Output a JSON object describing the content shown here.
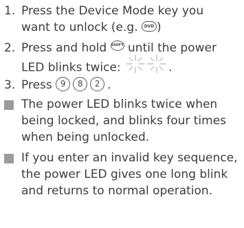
{
  "steps": [
    {
      "number": "1.",
      "line1": "Press the Device Mode key you",
      "line2_prefix": "want to unlock (e.g. ",
      "key_label": "DVD",
      "line2_suffix": ")"
    },
    {
      "number": "2.",
      "line1_prefix": "Press and hold ",
      "key_label": "SHIFT",
      "line1_suffix": " until the power",
      "line2_prefix": "LED blinks twice: ",
      "line2_suffix": "."
    },
    {
      "number": "3.",
      "prefix": "Press ",
      "keys": [
        "9",
        "8",
        "2"
      ],
      "suffix": "."
    }
  ],
  "notes": [
    "The power LED blinks twice when being locked, and blinks four times when being unlocked.",
    "If you enter an invalid key sequence, the power LED gives one long blink and returns to normal operation."
  ],
  "icons": {
    "blink": "led-blink-icon",
    "bullet": "square-bullet-icon"
  },
  "colors": {
    "text": "#3c3c3c",
    "bullet": "#9b9b9b",
    "key_border": "#555555"
  }
}
